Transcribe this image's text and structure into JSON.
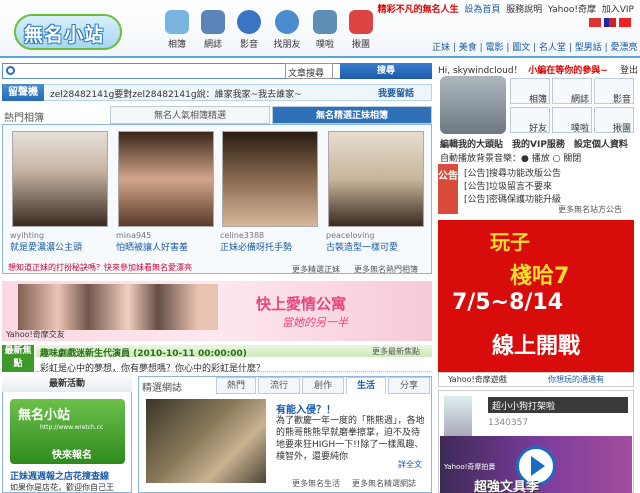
{
  "header": {
    "logo": "無名小站",
    "nav": [
      {
        "label": "相簿",
        "color": "#7ab5e0"
      },
      {
        "label": "網誌",
        "color": "#5c84b8"
      },
      {
        "label": "影音",
        "color": "#3b74c4"
      },
      {
        "label": "找朋友",
        "color": "#4a8ccd"
      },
      {
        "label": "噗啦",
        "color": "#5e8eb6"
      },
      {
        "label": "揪團",
        "color": "#d44"
      }
    ],
    "slogan": "精彩不凡的無名人生",
    "links": [
      "設為首頁",
      "服務說明",
      "Yahoo!奇摩",
      "加入VIP"
    ],
    "tags": "正妹 | 美食 | 電影 | 圖文 | 名人堂 | 型男話 | 愛漂亮"
  },
  "search": {
    "placeholder": "",
    "select": "文章搜尋",
    "button": "搜尋"
  },
  "guestbook": {
    "label": "留聲機",
    "text": "zel28482141g要對zel28482141g說：誰家我家~我去誰家~",
    "button": "我要留話"
  },
  "album": {
    "title": "熱門相簿",
    "tabs": [
      "無名人氣相簿精選",
      "無名精選正妹相簿"
    ],
    "photos": [
      {
        "user": "wyihting",
        "caption": "就是愛濃濃公主頭",
        "color": "#c9b6a6"
      },
      {
        "user": "mina945",
        "caption": "怕晒被讓人好害羞",
        "color": "#d3a58c"
      },
      {
        "user": "celine3388",
        "caption": "正妹必備呀托手勢",
        "color": "#8a6a4f"
      },
      {
        "user": "peaceloving",
        "caption": "古裝造型一樣可愛",
        "color": "#c7b59a"
      }
    ],
    "promo": "想知道正妹的打扮秘訣嗎？快來參加妹看無名愛漂亮",
    "more1": "更多精選正妹",
    "more2": "更多無名熱門相簿"
  },
  "banner": {
    "title": "快上愛情公寓",
    "subtitle": "當她的另一半",
    "source": "Yahoo!奇摩交友"
  },
  "news": {
    "label": "最新焦點",
    "headline": "趣味劇戲迷新生代演員 (2010-10-11 00:00:00)",
    "more": "更多最新焦點",
    "question": "彩虹是心中的夢想，你有夢想嗎？你心中的彩虹是什麼？"
  },
  "activity": {
    "title": "最新活動",
    "logo": "無名小站",
    "web": "http://www.wretch.cc",
    "join": "快來報名",
    "headline": "正妹週週報之店花搜查線",
    "desc": "如果你是店花，歡迎你自己王"
  },
  "selected": {
    "title": "精選網誌",
    "tabs": [
      "熱門",
      "流行",
      "創作",
      "生活",
      "分享"
    ],
    "active_tab": "生活",
    "headline": "有能入侵？！",
    "body": "為了歡慶一年一度的「熊熊週」，各地的熊哥熊熊早就磨拳擦掌，迫不及待地要來狂HIGH一下!!除了一樣風趣、樸智外，還要純你",
    "more": "詳全文",
    "foot1": "更多無名生活",
    "foot2": "更多無名精選網誌"
  },
  "sidebar": {
    "hello": "Hi, skywindcloud！",
    "welcome": "小編在等你的參與~",
    "logout": "登出",
    "buttons": [
      "相簿",
      "網誌",
      "影音",
      "好友",
      "噗啦",
      "揪團"
    ],
    "links": "編輯我的大頭貼　我的VIP服務　設定個人資料",
    "autoplay": "自動播放背景音樂：● 播放 ○ 關閉",
    "ann_label": "公告",
    "announcements": [
      "[公告]搜尋功能改版公告",
      "[公告]垃圾留言不要來",
      "[公告]密碼保護功能升級"
    ],
    "ann_more": "更多無名站方公告"
  },
  "ad": {
    "title1": "玩子",
    "title2": "棧哈7",
    "date": "7/5~8/14",
    "live": "線上開戰",
    "foot1": "Yahoo!奇摩遊戲",
    "foot2": "你想玩的通通有"
  },
  "video": {
    "title": "超小小狗打架啦",
    "count": "1340357",
    "source": "Yahoo!奇摩拍賣",
    "text": "超強文具季"
  }
}
